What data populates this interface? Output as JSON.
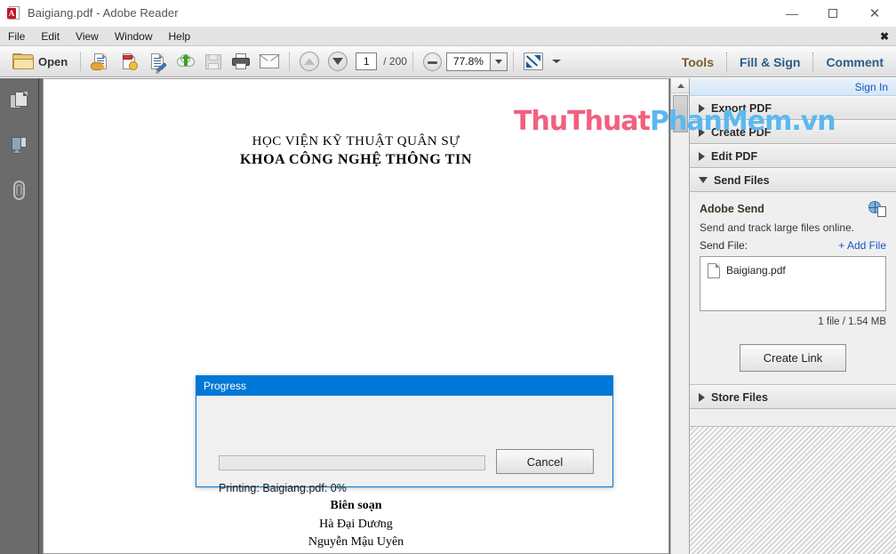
{
  "window": {
    "title": "Baigiang.pdf - Adobe Reader",
    "app_icon": "pdf-file-icon",
    "controls": {
      "minimize": "minimize-icon",
      "maximize": "maximize-icon",
      "close": "close-icon"
    }
  },
  "menubar": {
    "items": [
      "File",
      "Edit",
      "View",
      "Window",
      "Help"
    ],
    "close_label": "✖"
  },
  "toolbar": {
    "open_label": "Open",
    "icons": [
      "export-pdf-icon",
      "create-pdf-icon",
      "edit-pdf-icon",
      "cloud-upload-icon",
      "save-icon",
      "print-icon",
      "email-icon"
    ],
    "page_prev": "previous-page-icon",
    "page_next": "next-page-icon",
    "page_number": "1",
    "page_total": "/ 200",
    "zoom_out": "zoom-out-icon",
    "zoom_value": "77.8%",
    "zoom_dropdown": "chevron-down-icon",
    "fit_page": "fit-page-icon",
    "more_tools": "chevron-down-icon",
    "tasks": [
      "Tools",
      "Fill & Sign",
      "Comment"
    ]
  },
  "navrail": {
    "items": [
      "page-thumbnails-icon",
      "bookmarks-icon",
      "attachments-icon"
    ]
  },
  "document": {
    "heading_line1": "HỌC VIỆN KỸ THUẬT QUÂN SỰ",
    "heading_line2": "KHOA CÔNG NGHỆ THÔNG TIN",
    "footer_line1": "Biên soạn",
    "footer_line2": "Hà Đại Dương",
    "footer_line3": "Nguyễn Mậu Uyên"
  },
  "watermark": {
    "part1": "ThuThuat",
    "part2": "PhanMem",
    "part3": ".vn",
    "color1": "#f2607f",
    "color2": "#5bb8f0"
  },
  "taskpane": {
    "signin": "Sign In",
    "sections": [
      {
        "label": "Export PDF",
        "expanded": false
      },
      {
        "label": "Create PDF",
        "expanded": false
      },
      {
        "label": "Edit PDF",
        "expanded": false
      },
      {
        "label": "Send Files",
        "expanded": true
      },
      {
        "label": "Store Files",
        "expanded": false
      }
    ],
    "send_files": {
      "title": "Adobe Send",
      "icon": "globe-document-icon",
      "description": "Send and track large files online.",
      "send_file_label": "Send File:",
      "add_file_link": "+ Add File",
      "file_name": "Baigiang.pdf",
      "file_icon": "file-icon",
      "file_summary": "1 file / 1.54 MB",
      "create_link_button": "Create Link"
    }
  },
  "progress_dialog": {
    "title": "Progress",
    "status": "Printing: Baigiang.pdf: 0%",
    "percent": 0,
    "cancel_label": "Cancel",
    "accent_color": "#0078d7"
  }
}
